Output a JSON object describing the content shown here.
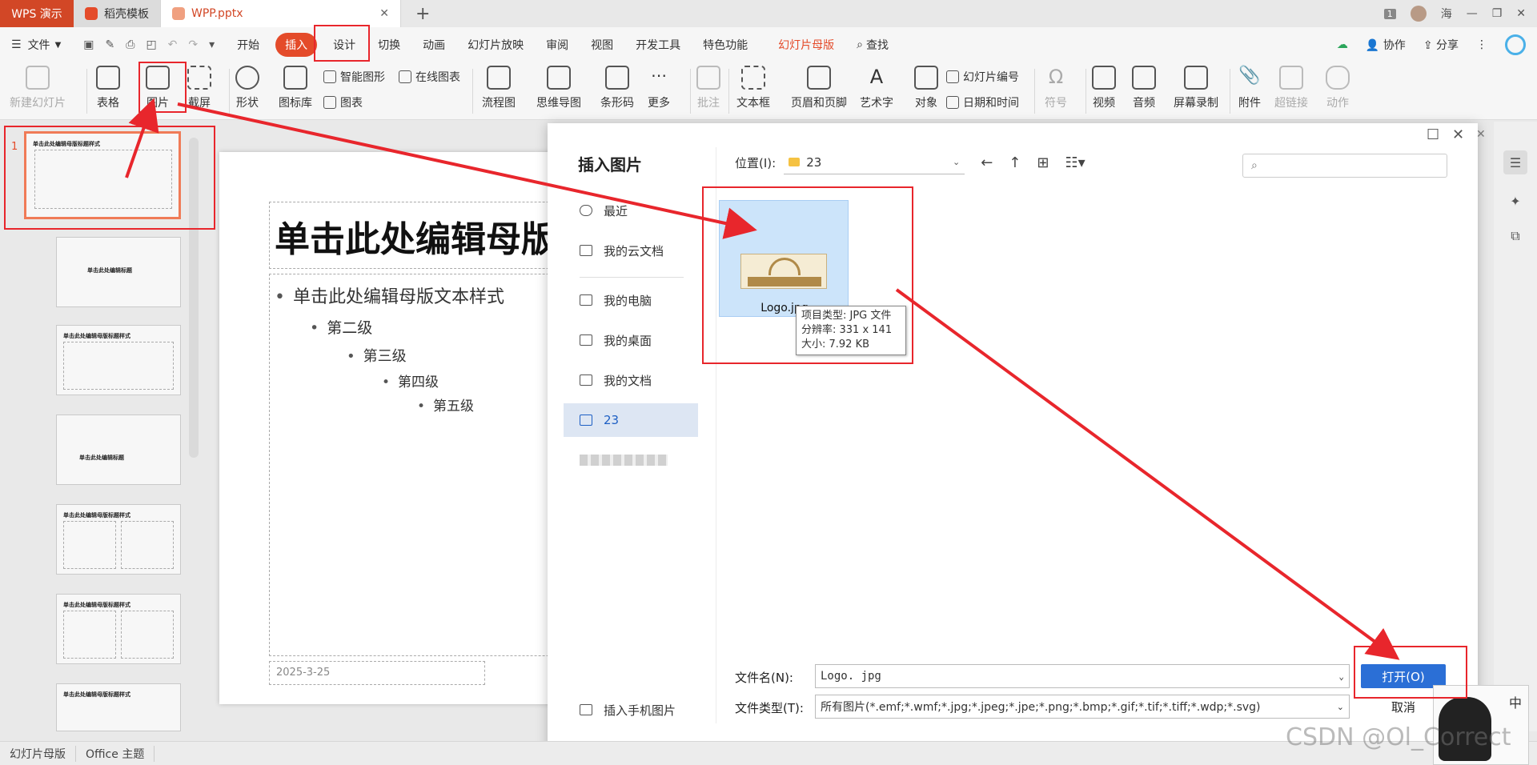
{
  "titlebar": {
    "app_tab": "WPS 演示",
    "tabs": [
      {
        "label": "稻壳模板",
        "color": "#e44b2a"
      },
      {
        "label": "WPP.pptx",
        "color": "#e44b2a"
      }
    ],
    "new_tab": "+",
    "page_badge": "1",
    "user": "海"
  },
  "menubar": {
    "file": "文件",
    "items": [
      "开始",
      "插入",
      "设计",
      "切换",
      "动画",
      "幻灯片放映",
      "审阅",
      "视图",
      "开发工具",
      "特色功能"
    ],
    "active": "插入",
    "master": "幻灯片母版",
    "search": "查找",
    "collab": "协作",
    "share": "分享"
  },
  "ribbon": {
    "new_slide": "新建幻灯片",
    "table": "表格",
    "picture": "图片",
    "screenshot": "截屏",
    "shape": "形状",
    "icon_lib": "图标库",
    "smart_shape": "智能图形",
    "online_chart": "在线图表",
    "chart": "图表",
    "flowchart": "流程图",
    "mindmap": "思维导图",
    "barcode": "条形码",
    "more": "更多",
    "comment": "批注",
    "textbox": "文本框",
    "header_footer": "页眉和页脚",
    "wordart": "艺术字",
    "object": "对象",
    "slide_number": "幻灯片编号",
    "datetime": "日期和时间",
    "symbol": "符号",
    "video": "视频",
    "audio": "音频",
    "screen_record": "屏幕录制",
    "attachment": "附件",
    "hyperlink": "超链接",
    "action": "动作"
  },
  "thumbnails": {
    "first_number": "1",
    "first_title": "单击此处编辑母版标题样式",
    "items": [
      "单击此处编辑标题",
      "单击此处编辑母版标题样式",
      "单击此处编辑标题",
      "单击此处编辑母版标题样式",
      "单击此处编辑母版标题样式",
      "单击此处编辑母版标题样式"
    ]
  },
  "slide": {
    "title": "单击此处编辑母版标题样式",
    "levels": [
      "单击此处编辑母版文本样式",
      "第二级",
      "第三级",
      "第四级",
      "第五级"
    ],
    "date": "2025-3-25"
  },
  "dialog": {
    "title": "插入图片",
    "sidebar": [
      "最近",
      "我的云文档",
      "我的电脑",
      "我的桌面",
      "我的文档",
      "23"
    ],
    "selected_folder": "23",
    "phone_picture": "插入手机图片",
    "location_label": "位置(I):",
    "location_value": "23",
    "file": {
      "name": "Logo.jpg"
    },
    "tooltip": [
      "项目类型: JPG 文件",
      "分辨率: 331 x 141",
      "大小: 7.92 KB"
    ],
    "filename_label": "文件名(N):",
    "filename_value": "Logo. jpg",
    "filetype_label": "文件类型(T):",
    "filetype_value": "所有图片(*.emf;*.wmf;*.jpg;*.jpeg;*.jpe;*.png;*.bmp;*.gif;*.tif;*.tiff;*.wdp;*.svg)",
    "open_button": "打开(O)",
    "cancel_button": "取消"
  },
  "statusbar": {
    "mode": "幻灯片母版",
    "theme": "Office 主题"
  },
  "watermark": "CSDN @Ol_Correct",
  "ime": "中",
  "colors": {
    "accent": "#e44b2a",
    "annotation": "#e8262c",
    "primary_button": "#2b6fd6"
  }
}
